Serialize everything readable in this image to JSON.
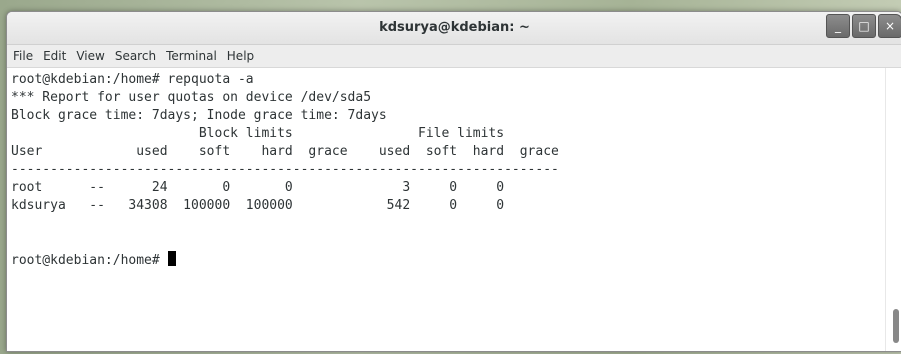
{
  "window": {
    "title": "kdsurya@kdebian: ~",
    "buttons": {
      "minimize": "_",
      "maximize": "□",
      "close": "×"
    }
  },
  "menu": [
    "File",
    "Edit",
    "View",
    "Search",
    "Terminal",
    "Help"
  ],
  "terminal": {
    "lines": [
      "root@kdebian:/home# repquota -a",
      "*** Report for user quotas on device /dev/sda5",
      "Block grace time: 7days; Inode grace time: 7days",
      "                        Block limits                File limits",
      "User            used    soft    hard  grace    used  soft  hard  grace",
      "----------------------------------------------------------------------",
      "root      --      24       0       0              3     0     0",
      "kdsurya   --   34308  100000  100000            542     0     0",
      "",
      ""
    ],
    "prompt": "root@kdebian:/home# "
  }
}
